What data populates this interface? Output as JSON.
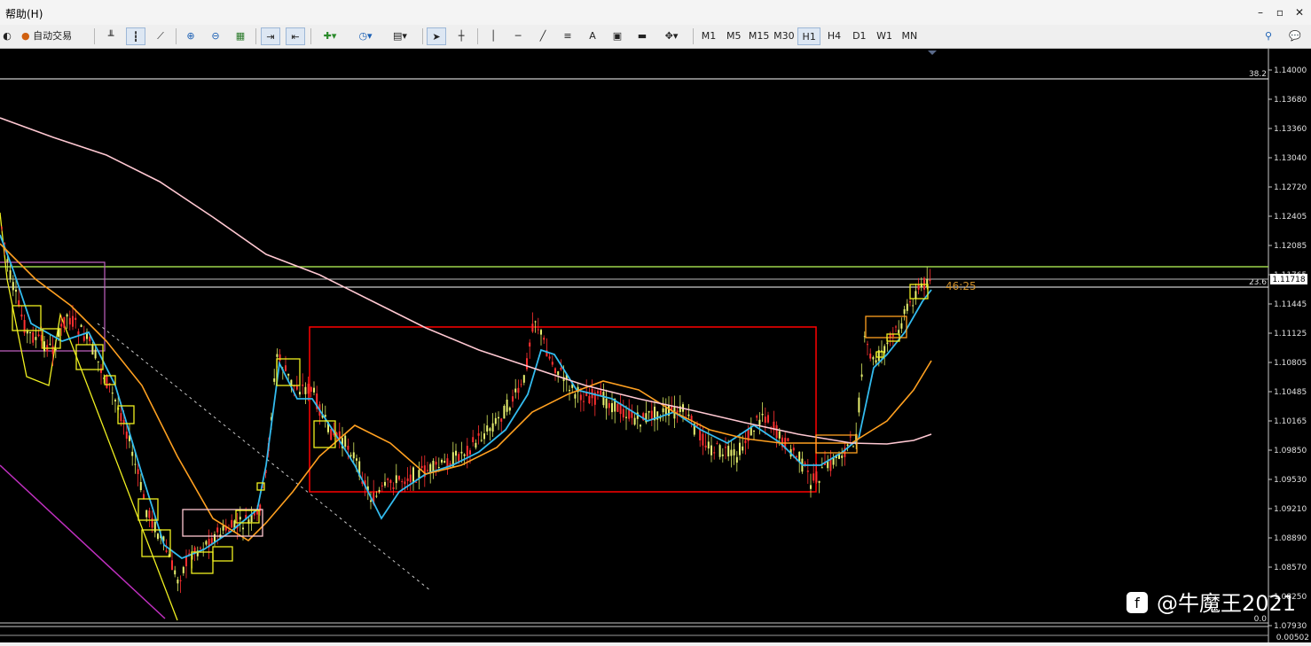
{
  "menu": {
    "help_label": "帮助(H)"
  },
  "window": {
    "minimize": "–",
    "restore": "▫",
    "close": "✕"
  },
  "toolbar": {
    "autotrade_label": "自动交易",
    "timeframes": [
      "M1",
      "M5",
      "M15",
      "M30",
      "H1",
      "H4",
      "D1",
      "W1",
      "MN"
    ],
    "active_timeframe": "H1",
    "text_tool": "A"
  },
  "chart": {
    "price_axis": [
      "1.14000",
      "1.13680",
      "1.13360",
      "1.13040",
      "1.12720",
      "1.12405",
      "1.12085",
      "1.11765",
      "1.11445",
      "1.11125",
      "1.10805",
      "1.10485",
      "1.10165",
      "1.09850",
      "1.09530",
      "1.09210",
      "1.08890",
      "1.08570",
      "1.08250",
      "1.07930"
    ],
    "current_price": "1.11718",
    "countdown": "46:25",
    "fibo_levels": [
      "38.2",
      "23.6",
      "0.0"
    ],
    "indicator_value": "0.00502",
    "watermark": "@牛魔王2021",
    "colors": {
      "background": "#000000",
      "fast_ma": "#33bbee",
      "slow_ma": "#ffa020",
      "long_ma": "#ffc8d2",
      "range_box": "#ff0000",
      "resistance": "#9ed64a",
      "fibo": "#ffffff",
      "countdown": "#d0902a"
    }
  }
}
